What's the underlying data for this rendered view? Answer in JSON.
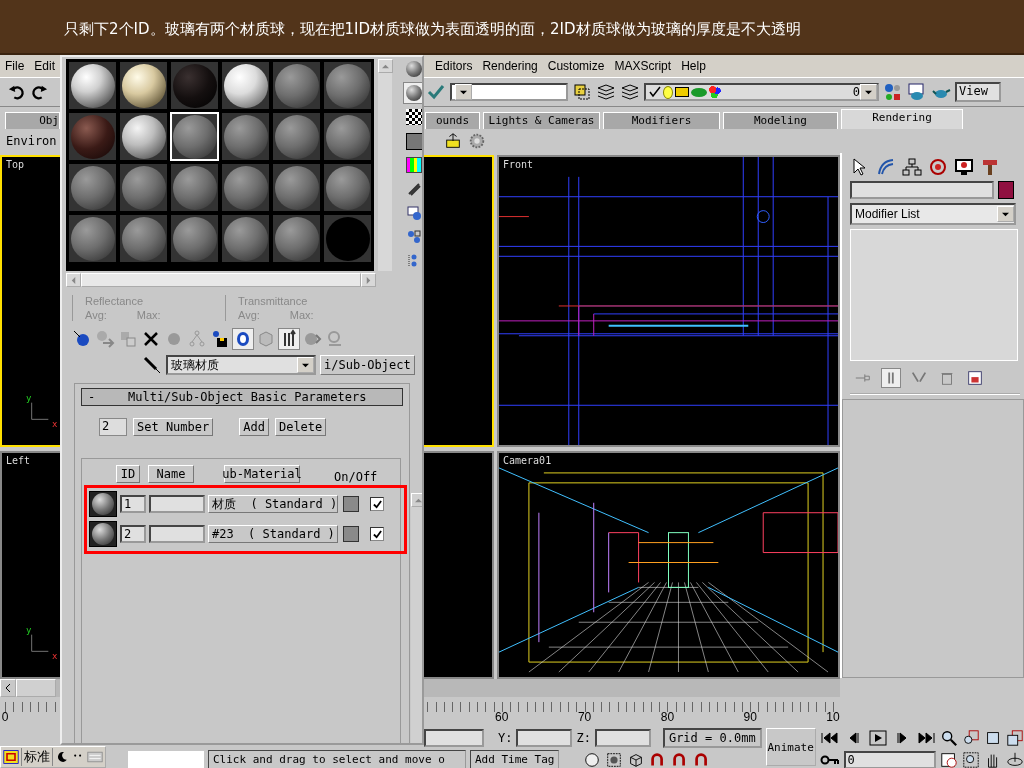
{
  "caption": "只剩下2个ID。玻璃有两个材质球，现在把1ID材质球做为表面透明的面，2ID材质球做为玻璃的厚度是不大透明",
  "menu_left": [
    "File",
    "Edit"
  ],
  "menu_right": [
    "Editors",
    "Rendering",
    "Customize",
    "MAXScript",
    "Help"
  ],
  "toolbar": {
    "layer": "0",
    "view": "View"
  },
  "tabs": [
    {
      "label": "Obj",
      "selected": false
    },
    {
      "label": "ounds",
      "selected": false
    },
    {
      "label": "Lights & Cameras",
      "selected": false
    },
    {
      "label": "Modifiers",
      "selected": false
    },
    {
      "label": "Modeling",
      "selected": false
    },
    {
      "label": "Rendering",
      "selected": true
    }
  ],
  "environ": "Environ",
  "viewports": [
    {
      "label": "Top",
      "kind": "empty",
      "selected": true,
      "axis_y": "y",
      "axis_x": "x"
    },
    {
      "label": "Front",
      "kind": "front",
      "selected": false
    },
    {
      "label": "Left",
      "kind": "empty",
      "selected": false,
      "axis_y": "y",
      "axis_x": "x"
    },
    {
      "label": "Camera01",
      "kind": "camera",
      "selected": false
    }
  ],
  "command_panel": {
    "modifier_list": "Modifier List"
  },
  "material_editor": {
    "slots": [
      {
        "kind": "white",
        "selected": false
      },
      {
        "kind": "cream",
        "selected": false
      },
      {
        "kind": "dark",
        "selected": false
      },
      {
        "kind": "marble",
        "selected": false
      },
      {
        "kind": "grey",
        "selected": false
      },
      {
        "kind": "grey",
        "selected": false
      },
      {
        "kind": "brown",
        "selected": false
      },
      {
        "kind": "silver",
        "selected": false
      },
      {
        "kind": "grey",
        "selected": true
      },
      {
        "kind": "grey",
        "selected": false
      },
      {
        "kind": "grey",
        "selected": false
      },
      {
        "kind": "grey",
        "selected": false
      },
      {
        "kind": "grey",
        "selected": false
      },
      {
        "kind": "grey",
        "selected": false
      },
      {
        "kind": "grey",
        "selected": false
      },
      {
        "kind": "grey",
        "selected": false
      },
      {
        "kind": "grey",
        "selected": false
      },
      {
        "kind": "grey",
        "selected": false
      },
      {
        "kind": "grey",
        "selected": false
      },
      {
        "kind": "grey",
        "selected": false
      },
      {
        "kind": "grey",
        "selected": false
      },
      {
        "kind": "grey",
        "selected": false
      },
      {
        "kind": "grey",
        "selected": false
      },
      {
        "kind": "empty",
        "selected": false
      }
    ],
    "reflectance": {
      "title": "Reflectance",
      "avg": "Avg:",
      "max": "Max:"
    },
    "transmittance": {
      "title": "Transmittance",
      "avg": "Avg:",
      "max": "Max:"
    },
    "material_name": "玻璃材质",
    "type_button": "i/Sub-Object",
    "rollout": {
      "collapse": "-",
      "title": "Multi/Sub-Object Basic Parameters",
      "count": "2",
      "set_number": "Set Number",
      "add": "Add",
      "delete": "Delete",
      "headers": {
        "id": "ID",
        "name": "Name",
        "sub_material": "ub-Material",
        "on_off": "On/Off"
      },
      "rows": [
        {
          "id": "1",
          "material": "材质  ( Standard )",
          "on": true
        },
        {
          "id": "2",
          "material": "#23  ( Standard )",
          "on": true
        }
      ]
    }
  },
  "time_slider": {
    "level": 0
  },
  "ruler": [
    "0",
    "60",
    "70",
    "80",
    "90",
    "10"
  ],
  "status": {
    "y_label": "Y:",
    "z_label": "Z:",
    "grid": "Grid = 0.0mm",
    "animate": "Animate",
    "frame": "0",
    "prompt": "Click and drag to select and move o",
    "add_time_tag": "Add Time Tag"
  },
  "ime": {
    "mode": "标准"
  }
}
